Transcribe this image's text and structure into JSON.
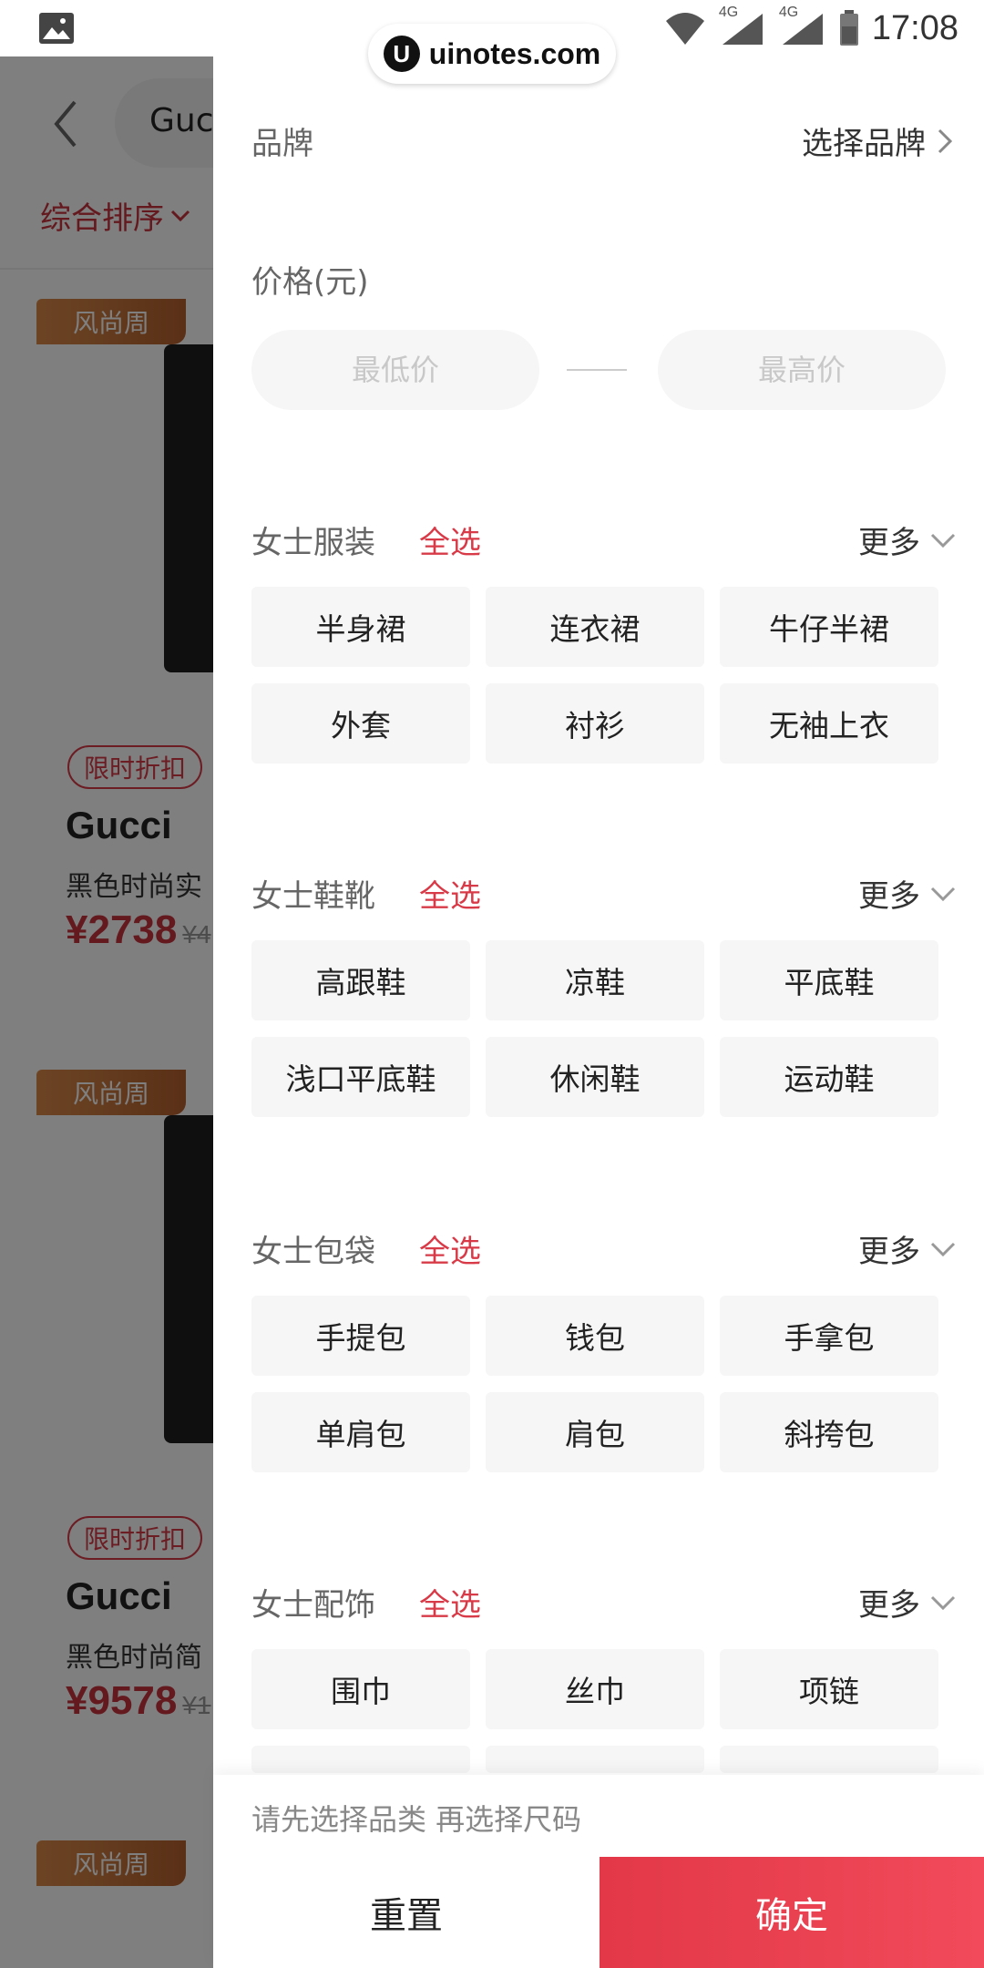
{
  "status_bar": {
    "time": "17:08",
    "network_1": "4G",
    "network_2": "4G",
    "watermark": "uinotes.com"
  },
  "background": {
    "search_text": "Gucci",
    "sort_label": "综合排序",
    "cards": [
      {
        "badge": "风尚周",
        "tag": "限时折扣",
        "brand": "Gucci",
        "desc": "黑色时尚实",
        "price": "¥2738",
        "orig_price": "¥4"
      },
      {
        "badge": "风尚周",
        "tag": "限时折扣",
        "brand": "Gucci",
        "desc": "黑色时尚简",
        "price": "¥9578",
        "orig_price": "¥1"
      },
      {
        "badge": "风尚周"
      }
    ]
  },
  "filter": {
    "brand_label": "品牌",
    "brand_select": "选择品牌",
    "price_label": "价格(元)",
    "price_min_placeholder": "最低价",
    "price_max_placeholder": "最高价",
    "sections": [
      {
        "title": "女士服装",
        "select_all": "全选",
        "more": "更多",
        "items": [
          "半身裙",
          "连衣裙",
          "牛仔半裙",
          "外套",
          "衬衫",
          "无袖上衣"
        ]
      },
      {
        "title": "女士鞋靴",
        "select_all": "全选",
        "more": "更多",
        "items": [
          "高跟鞋",
          "凉鞋",
          "平底鞋",
          "浅口平底鞋",
          "休闲鞋",
          "运动鞋"
        ]
      },
      {
        "title": "女士包袋",
        "select_all": "全选",
        "more": "更多",
        "items": [
          "手提包",
          "钱包",
          "手拿包",
          "单肩包",
          "肩包",
          "斜挎包"
        ]
      },
      {
        "title": "女士配饰",
        "select_all": "全选",
        "more": "更多",
        "items": [
          "围巾",
          "丝巾",
          "项链"
        ]
      }
    ],
    "hint": "请先选择品类 再选择尺码",
    "reset_label": "重置",
    "confirm_label": "确定"
  },
  "colors": {
    "accent_red": "#d83a47",
    "confirm_gradient_start": "#e23848",
    "confirm_gradient_end": "#f24a5a",
    "badge_orange": "#c46a33"
  }
}
